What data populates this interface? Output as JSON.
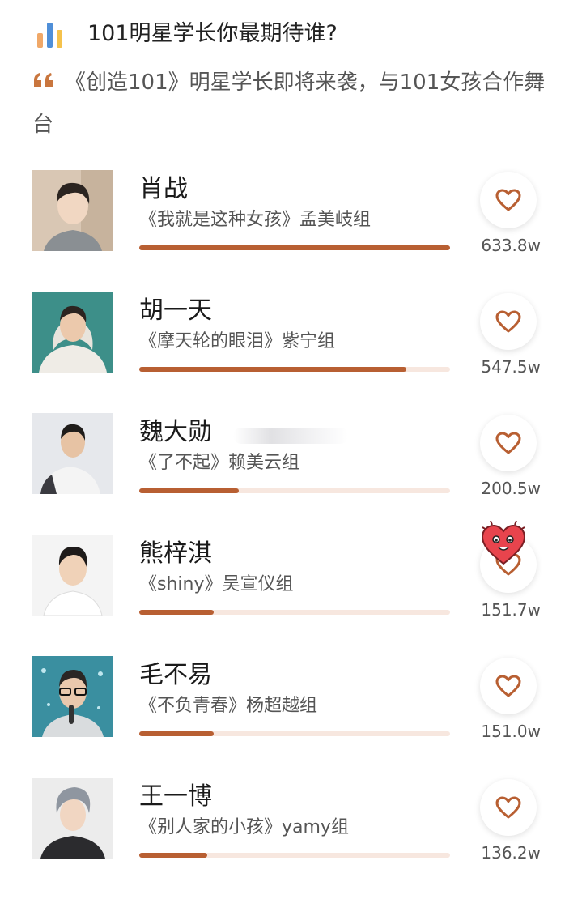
{
  "poll": {
    "title": "101明星学长你最期待谁?",
    "description": "《创造101》明星学长即将来袭，与101女孩合作舞台",
    "icon": "bar-chart-icon",
    "quote_icon": "quote-icon"
  },
  "colors": {
    "accent": "#b85f32",
    "track": "#f7e7df",
    "icon_bar_1": "#f0a868",
    "icon_bar_2": "#4f8fd8",
    "icon_bar_3": "#f5c24c"
  },
  "candidates": [
    {
      "name": "肖战",
      "song": "《我就是这种女孩》孟美岐组",
      "votes": "633.8w",
      "progress": 1.0
    },
    {
      "name": "胡一天",
      "song": "《摩天轮的眼泪》紫宁组",
      "votes": "547.5w",
      "progress": 0.86
    },
    {
      "name": "魏大勋",
      "song": "《了不起》赖美云组",
      "votes": "200.5w",
      "progress": 0.32
    },
    {
      "name": "熊梓淇",
      "song": "《shiny》吴宣仪组",
      "votes": "151.7w",
      "progress": 0.24
    },
    {
      "name": "毛不易",
      "song": "《不负青春》杨超越组",
      "votes": "151.0w",
      "progress": 0.24
    },
    {
      "name": "王一博",
      "song": "《别人家的小孩》yamy组",
      "votes": "136.2w",
      "progress": 0.22
    }
  ]
}
